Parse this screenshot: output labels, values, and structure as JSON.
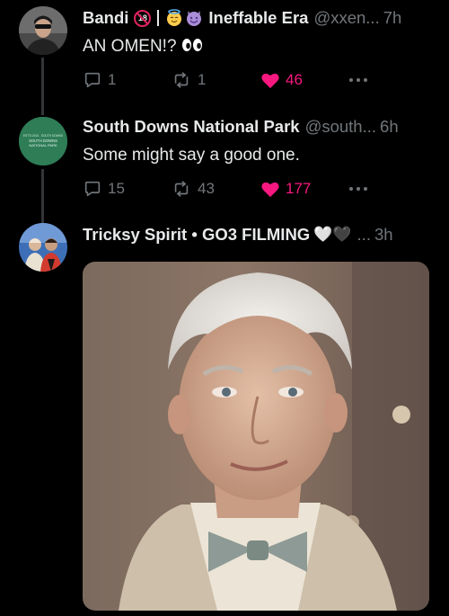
{
  "tweets": [
    {
      "display_name": "Bandi",
      "name_suffix": "Ineffable Era",
      "handle": "@xxen...",
      "time": "7h",
      "badge_18": "18",
      "text": "AN OMEN!? ",
      "text_emoji": "👀",
      "replies": "1",
      "retweets": "1",
      "likes": "46"
    },
    {
      "display_name": "South Downs National Park",
      "handle": "@south...",
      "time": "6h",
      "text": "Some might say a good one.",
      "replies": "15",
      "retweets": "43",
      "likes": "177",
      "avatar_text": [
        "EST'D 2010 - SOUTH DOWNS",
        "SOUTH DOWNS",
        "NATIONAL PARK"
      ]
    },
    {
      "display_name": "Tricksy Spirit • GO3 FILMING",
      "display_name_hearts": "🤍🖤",
      "handle": "...",
      "time": "3h"
    }
  ],
  "icons": {
    "reply": "reply-icon",
    "retweet": "retweet-icon",
    "like": "heart-filled-icon",
    "more": "more-icon"
  },
  "colors": {
    "background": "#000000",
    "text": "#e7e9ea",
    "muted": "#71767b",
    "like": "#f91880",
    "thread_line": "#333639",
    "park_green": "#2e7d57"
  }
}
